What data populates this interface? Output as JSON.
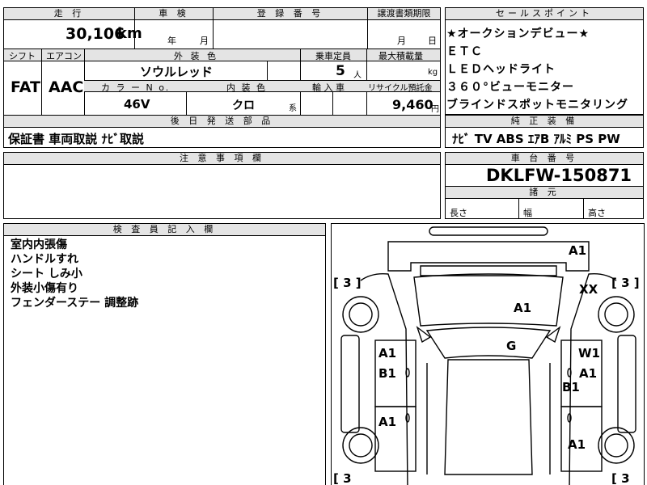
{
  "top": {
    "mileage_label": "走 行",
    "mileage": "30,106",
    "mileage_unit": "km",
    "inspection_label": "車 検",
    "year_unit": "年",
    "month_unit": "月",
    "registration_label": "登 録 番 号",
    "transfer_label": "譲渡書類期限",
    "transfer_month": "月",
    "transfer_day": "日"
  },
  "row2": {
    "shift_label": "シフト",
    "aircon_label": "エアコン",
    "exterior_label": "外 装 色",
    "capacity_label": "乗車定員",
    "load_label": "最大積載量",
    "shift": "FAT",
    "aircon": "AAC",
    "exterior_color": "ソウルレッド",
    "capacity": "5",
    "capacity_unit": "人",
    "load_unit": "kg",
    "color_no_label": "カ ラ ー N o.",
    "interior_label": "内 装 色",
    "import_label": "輸 入 車",
    "recycle_label": "リサイクル預託金",
    "color_no": "46V",
    "interior_color": "クロ",
    "interior_suffix": "系",
    "recycle_fee": "9,460",
    "recycle_unit": "円"
  },
  "later_parts": {
    "label": "後 日 発 送 部 品",
    "value": "保証書 車両取説 ﾅﾋﾞ取説"
  },
  "caution": {
    "label": "注 意 事 項 欄"
  },
  "sales_points": {
    "label": "セールスポイント",
    "items": [
      "★オークションデビュー★",
      "ＥＴＣ",
      "ＬＥＤヘッドライト",
      "３６０°ビューモニター",
      "ブラインドスポットモニタリング"
    ]
  },
  "equipment": {
    "label": "純 正 装 備",
    "value": "ﾅﾋﾞ TV ABS ｴｱB ｱﾙﾐ PS PW"
  },
  "chassis": {
    "label": "車 台 番 号",
    "value": "DKLFW-150871"
  },
  "dimensions": {
    "label": "諸 元",
    "length_label": "長さ",
    "width_label": "幅",
    "height_label": "高さ"
  },
  "inspector": {
    "label": "検 査 員 記 入 欄",
    "notes": [
      "室内内張傷",
      "ハンドルすれ",
      "シート しみ小",
      "外装小傷有り",
      "フェンダーステー 調整跡"
    ]
  },
  "diagram": {
    "tire_left_front": "[ 3 ]",
    "tire_right_front": "[ 3 ]",
    "tire_left_rear": "[ 3",
    "tire_right_rear": "[ 3",
    "marks": {
      "front_bumper": "A1",
      "hood_corner": "XX",
      "hood": "A1",
      "windshield": "G",
      "left_front_door": "A1",
      "left_front_door_b": "B1",
      "left_rear_door": "A1",
      "right_front_door": "W1",
      "right_front_door_b": "A1",
      "right_pillar": "B1",
      "right_rear_fender": "A1"
    }
  }
}
